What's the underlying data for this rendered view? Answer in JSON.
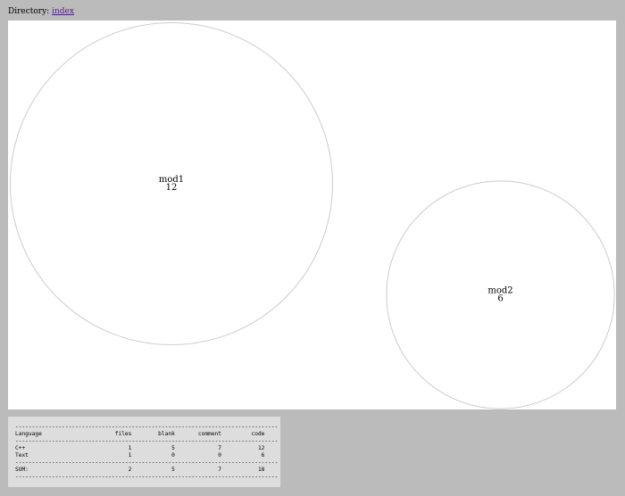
{
  "breadcrumb": {
    "label": "Directory:",
    "link_text": "index",
    "link_color": "#551a8b"
  },
  "chart_data": {
    "type": "bubble",
    "nodes": [
      {
        "name": "mod1",
        "value": 12
      },
      {
        "name": "mod2",
        "value": 6
      }
    ]
  },
  "stats": {
    "separator": "-------------------------------------------------------------------------------",
    "columns": [
      "Language",
      "files",
      "blank",
      "comment",
      "code"
    ],
    "rows": [
      {
        "language": "C++",
        "files": "1",
        "blank": "5",
        "comment": "7",
        "code": "12"
      },
      {
        "language": "Text",
        "files": "1",
        "blank": "0",
        "comment": "0",
        "code": "6"
      }
    ],
    "total": {
      "language": "SUM:",
      "files": "2",
      "blank": "5",
      "comment": "7",
      "code": "18"
    }
  },
  "colors": {
    "page_background": "#bbbbbb",
    "chart_background": "#ffffff",
    "bubble_stroke": "#cccccc",
    "stats_background": "#dddddd"
  }
}
